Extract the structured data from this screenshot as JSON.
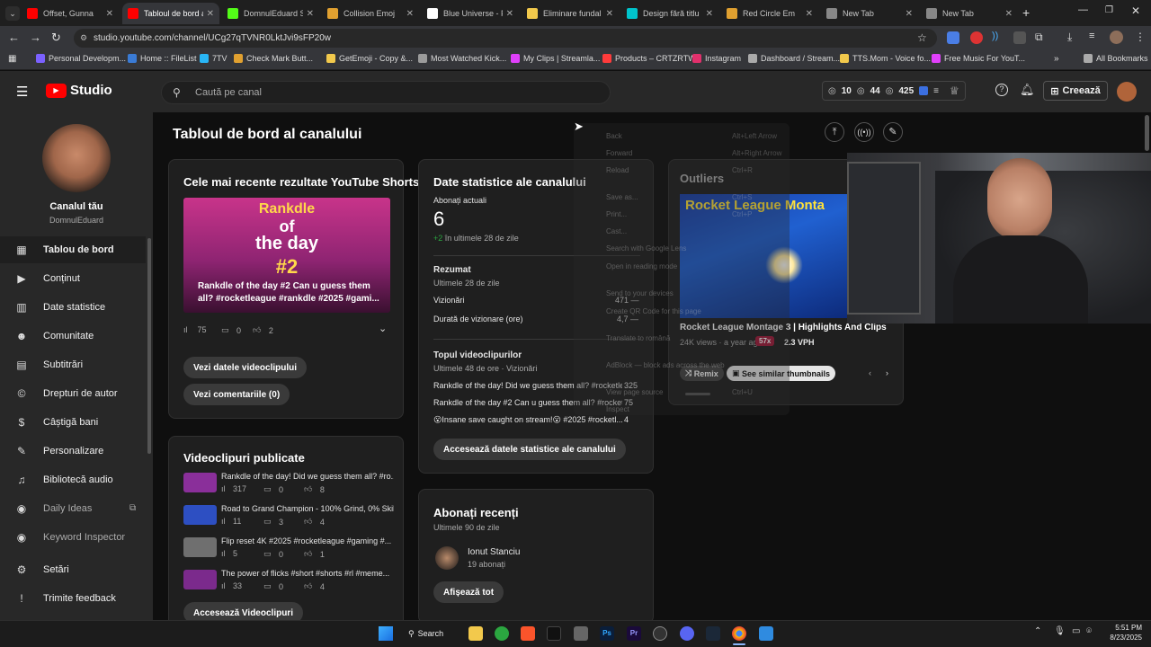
{
  "browser": {
    "tabs": [
      {
        "label": "Offset, Gunna",
        "color": "#ff0000"
      },
      {
        "label": "Tabloul de bord al",
        "color": "#ff0000"
      },
      {
        "label": "DomnulEduard St",
        "color": "#53fc18"
      },
      {
        "label": "Collision Emoj",
        "color": "#e0a030"
      },
      {
        "label": "Blue Universe - Fr",
        "color": "#ffffff"
      },
      {
        "label": "Eliminare fundal",
        "color": "#f2c94c"
      },
      {
        "label": "Design fără titlu",
        "color": "#00c4cc"
      },
      {
        "label": "Red Circle Em",
        "color": "#e0a030"
      },
      {
        "label": "New Tab",
        "color": "#888888"
      },
      {
        "label": "New Tab",
        "color": "#888888"
      }
    ],
    "url": "studio.youtube.com/channel/UCg27qTVNR0LktJvi9sFP20w",
    "bookmarks": [
      {
        "label": "Personal Developm...",
        "color": "#7b61ff"
      },
      {
        "label": "Home :: FileList",
        "color": "#3a7bd5"
      },
      {
        "label": "7TV",
        "color": "#29b6f6"
      },
      {
        "label": "Check Mark Butt...",
        "color": "#e0a030"
      },
      {
        "label": "GetEmoji - Copy &...",
        "color": "#f2c94c"
      },
      {
        "label": "Most Watched Kick...",
        "color": "#9b9b9b"
      },
      {
        "label": "My Clips | Streamla...",
        "color": "#e040fb"
      },
      {
        "label": "Products – CRTZRTW",
        "color": "#ff3b3b"
      },
      {
        "label": "Instagram",
        "color": "#e1306c"
      },
      {
        "label": "Dashboard / Stream...",
        "color": "#aaaaaa"
      },
      {
        "label": "TTS.Mom - Voice fo...",
        "color": "#f2c94c"
      },
      {
        "label": "Free Music For YouT...",
        "color": "#e040fb"
      }
    ],
    "all_bookmarks": "All Bookmarks"
  },
  "studio": {
    "logo": "Studio",
    "search_placeholder": "Caută pe canal",
    "stats": {
      "a": "10",
      "b": "44",
      "c": "425"
    },
    "create_label": "Creează"
  },
  "channel": {
    "name": "Canalul tău",
    "handle": "DomnulEduard"
  },
  "nav": [
    {
      "label": "Tablou de bord",
      "icon": "▦",
      "active": true
    },
    {
      "label": "Conținut",
      "icon": "▶"
    },
    {
      "label": "Date statistice",
      "icon": "▥"
    },
    {
      "label": "Comunitate",
      "icon": "☻"
    },
    {
      "label": "Subtitrări",
      "icon": "▤"
    },
    {
      "label": "Drepturi de autor",
      "icon": "©"
    },
    {
      "label": "Câștigă bani",
      "icon": "$"
    },
    {
      "label": "Personalizare",
      "icon": "✎"
    },
    {
      "label": "Bibliotecă audio",
      "icon": "♫"
    },
    {
      "label": "Daily Ideas",
      "icon": "◉",
      "dim": true
    },
    {
      "label": "Keyword Inspector",
      "icon": "◉",
      "dim": true
    },
    {
      "label": "Setări",
      "icon": "⚙"
    },
    {
      "label": "Trimite feedback",
      "icon": "!"
    }
  ],
  "page_title": "Tabloul de bord al canalului",
  "shorts": {
    "title": "Cele mai recente rezultate YouTube Shorts",
    "thumb_text1": "Rankdle",
    "thumb_text2": "of",
    "thumb_text3": "the day",
    "thumb_text4": "#2",
    "caption": "Rankdle of the day #2 Can u guess them all? #rocketleague #rankdle #2025 #gami...",
    "views": "75",
    "comments": "0",
    "likes": "2",
    "btn_data": "Vezi datele videoclipului",
    "btn_comments": "Vezi comentariile (0)"
  },
  "published": {
    "title": "Videoclipuri publicate",
    "items": [
      {
        "title": "Rankdle of the day! Did we guess them all? #ro...",
        "views": "317",
        "comments": "0",
        "likes": "8",
        "color": "#8a2f9a"
      },
      {
        "title": "Road to Grand Champion - 100% Grind, 0% Skill...",
        "views": "11",
        "comments": "3",
        "likes": "4",
        "color": "#2d4fc2"
      },
      {
        "title": "Flip reset 4K #2025 #rocketleague #gaming #...",
        "views": "5",
        "comments": "0",
        "likes": "1",
        "color": "#6f6f6f"
      },
      {
        "title": "The power of flicks #short #shorts #rl #meme...",
        "views": "33",
        "comments": "0",
        "likes": "4",
        "color": "#7b2a8c"
      }
    ],
    "btn": "Accesează Videoclipuri"
  },
  "analytics": {
    "title": "Date statistice ale canalului",
    "subs_label": "Abonați actuali",
    "subs_value": "6",
    "subs_delta_a": "+2",
    "subs_delta_b": " în ultimele 28 de zile",
    "summary_title": "Rezumat",
    "summary_sub": "Ultimele 28 de zile",
    "views_label": "Vizionări",
    "views_value": "471",
    "watch_label": "Durată de vizionare (ore)",
    "watch_value": "4,7",
    "top_title": "Topul videoclipurilor",
    "top_sub": "Ultimele 48 de ore · Vizionări",
    "top": [
      {
        "title": "Rankdle of the day! Did we guess them all? #rocketle...",
        "value": "325"
      },
      {
        "title": "Rankdle of the day #2 Can u guess them all? #rocketl...",
        "value": "75"
      },
      {
        "title": "😮Insane save caught on stream!😮 #2025 #rocketl...",
        "value": "4"
      }
    ],
    "btn": "Accesează datele statistice ale canalului"
  },
  "recent_subs": {
    "title": "Abonați recenți",
    "sub": "Ultimele 90 de zile",
    "name": "Ionut Stanciu",
    "count": "19 abonați",
    "btn": "Afișează tot"
  },
  "outliers": {
    "title": "Outliers",
    "thumb_text": "Rocket League Monta",
    "video_title": "Rocket League Montage 3 | Highlights And Clips",
    "meta": "24K views · a year ago",
    "mult": "57x",
    "vph": "2.3 VPH",
    "remix": "Remix",
    "similar": "See similar thumbnails"
  },
  "context_menu": [
    {
      "label": "Back",
      "key": "Alt+Left Arrow"
    },
    {
      "label": "Forward",
      "key": "Alt+Right Arrow"
    },
    {
      "label": "Reload",
      "key": "Ctrl+R"
    },
    {
      "label": "Save as...",
      "key": "Ctrl+S"
    },
    {
      "label": "Print...",
      "key": "Ctrl+P"
    },
    {
      "label": "Cast...",
      "key": ""
    },
    {
      "label": "Search with Google Lens",
      "key": ""
    },
    {
      "label": "Open in reading mode",
      "key": ""
    },
    {
      "label": "Send to your devices",
      "key": ""
    },
    {
      "label": "Create QR Code for this page",
      "key": ""
    },
    {
      "label": "Translate to română",
      "key": ""
    },
    {
      "label": "AdBlock — block ads across the web",
      "key": ""
    },
    {
      "label": "View page source",
      "key": "Ctrl+U"
    },
    {
      "label": "Inspect",
      "key": ""
    }
  ],
  "taskbar": {
    "search": "Search",
    "time": "5:51 PM",
    "date": "8/23/2025"
  }
}
